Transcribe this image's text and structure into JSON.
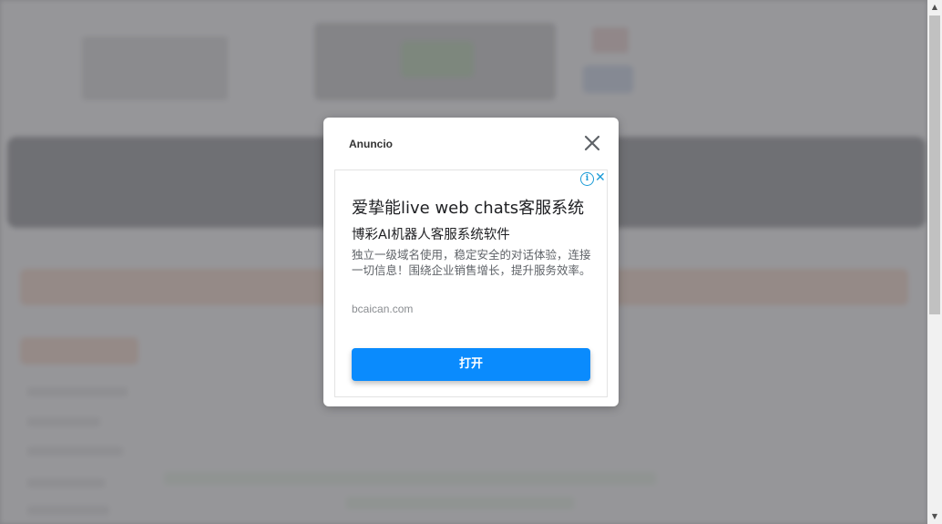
{
  "modal": {
    "title": "Anuncio",
    "close_icon": "close-icon"
  },
  "ad": {
    "info_icon": "info-icon",
    "close_icon": "close-icon",
    "headline": "爱挚能live web chats客服系统",
    "subheadline": "博彩AI机器人客服系统软件",
    "description": "独立一级域名使用，稳定安全的对话体验，连接一切信息！围绕企业销售增长，提升服务效率。",
    "display_url": "bcaican.com",
    "cta_label": "打开",
    "cta_color": "#0a8bfd"
  },
  "colors": {
    "overlay": "#7d7e82",
    "nav_bar": "#3e4046",
    "banner": "#e6b59a"
  }
}
